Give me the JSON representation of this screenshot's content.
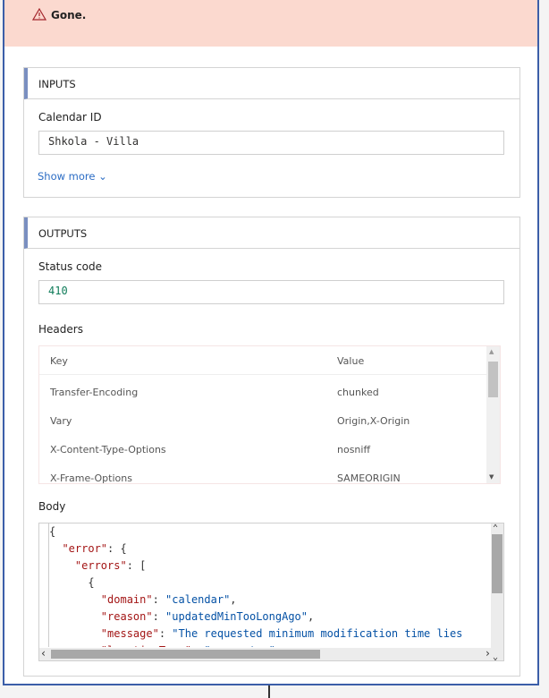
{
  "banner": {
    "icon": "warning-icon",
    "message": "Gone."
  },
  "inputs": {
    "title": "INPUTS",
    "calendar_id_label": "Calendar ID",
    "calendar_id_value": "Shkola - Villa",
    "show_more": "Show more"
  },
  "outputs": {
    "title": "OUTPUTS",
    "status_code_label": "Status code",
    "status_code_value": "410",
    "headers_label": "Headers",
    "headers_columns": [
      "Key",
      "Value"
    ],
    "headers_rows": [
      [
        "Transfer-Encoding",
        "chunked"
      ],
      [
        "Vary",
        "Origin,X-Origin"
      ],
      [
        "X-Content-Type-Options",
        "nosniff"
      ],
      [
        "X-Frame-Options",
        "SAMEORIGIN"
      ]
    ],
    "body_label": "Body",
    "body_lines": [
      "{",
      "  \"error\": {",
      "    \"errors\": [",
      "      {",
      "        \"domain\": \"calendar\",",
      "        \"reason\": \"updatedMinTooLongAgo\",",
      "        \"message\": \"The requested minimum modification time lies",
      "        \"locationType\": \"parameter\","
    ]
  },
  "colors": {
    "banner_bg": "#fbd9cf",
    "accent": "#3b5ea8",
    "status_value": "#107c5a",
    "json_key": "#a31515",
    "json_string": "#0451a5"
  }
}
